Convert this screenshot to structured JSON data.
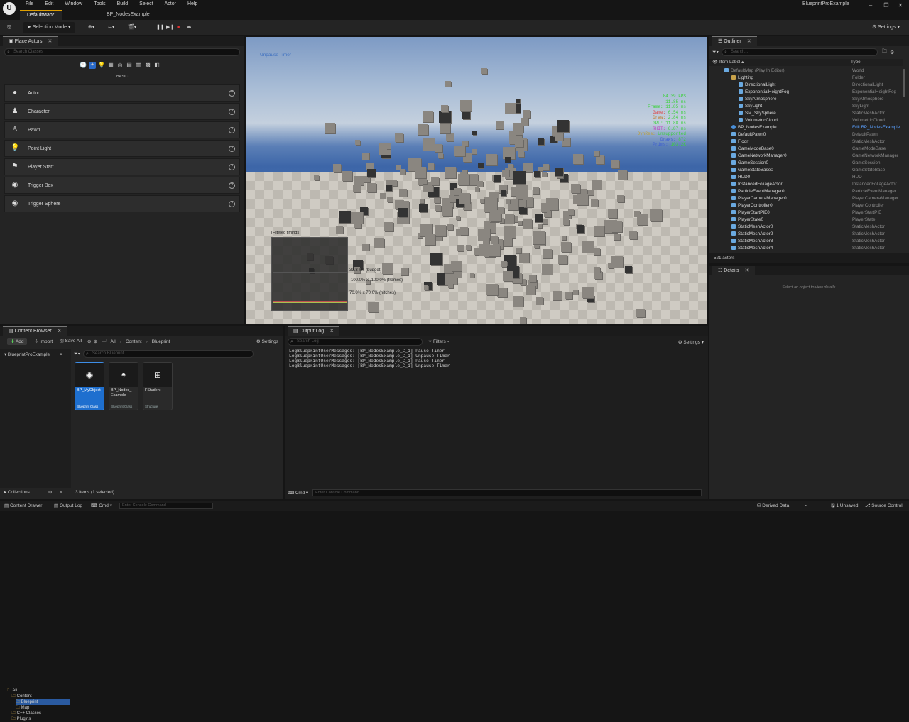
{
  "app": {
    "menu": [
      "File",
      "Edit",
      "Window",
      "Tools",
      "Build",
      "Select",
      "Actor",
      "Help"
    ],
    "tabs": [
      {
        "label": "DefaultMap*",
        "active": true
      },
      {
        "label": "BP_NodesExample",
        "active": false
      }
    ],
    "window_title": "BlueprintProExample",
    "accent": "#e0a000"
  },
  "toolbar": {
    "selection_mode": "Selection Mode",
    "settings_label": "Settings"
  },
  "place_actors": {
    "tab_label": "Place Actors",
    "search_placeholder": "Search Classes",
    "category_label": "BASIC",
    "items": [
      {
        "label": "Actor",
        "icon": "actor-sphere-icon"
      },
      {
        "label": "Character",
        "icon": "character-icon"
      },
      {
        "label": "Pawn",
        "icon": "pawn-icon"
      },
      {
        "label": "Point Light",
        "icon": "light-bulb-icon"
      },
      {
        "label": "Player Start",
        "icon": "flag-icon"
      },
      {
        "label": "Trigger Box",
        "icon": "trigger-box-icon"
      },
      {
        "label": "Trigger Sphere",
        "icon": "trigger-sphere-icon"
      }
    ]
  },
  "viewport": {
    "overlay_text": "Unpause Timer",
    "stats": [
      {
        "label": "",
        "value": "84.39 FPS",
        "color": "#3ad13a"
      },
      {
        "label": "",
        "value": "11.85 ms",
        "color": "#3ad13a"
      },
      {
        "label": "Frame:",
        "value": "11.85 ms",
        "color": "#3ad13a"
      },
      {
        "label": "Game:",
        "value": "6.54 ms",
        "color": "#e04040"
      },
      {
        "label": "Draw:",
        "value": "2.84 ms",
        "color": "#c27a2a"
      },
      {
        "label": "GPU:",
        "value": "11.88 ms",
        "color": "#3ad13a"
      },
      {
        "label": "RHIT:",
        "value": "6.87 ms",
        "color": "#c040c0"
      },
      {
        "label": "DynRes:",
        "value": "Unsupported",
        "color": "#c0a030"
      },
      {
        "label": "Draws:",
        "value": "872",
        "color": "#4060d0"
      },
      {
        "label": "Prims:",
        "value": "103.2K",
        "color": "#4060d0"
      }
    ],
    "graph_title": "(Filtered timings)",
    "graph_labels": [
      "33.3 ms (budget)",
      "-100.0% x -100.0% (frames)",
      "70.0% x 70.0% (hitches)"
    ]
  },
  "outliner": {
    "tab_label": "Outliner",
    "search_placeholder": "Search...",
    "col_label": "Item Label ▴",
    "col_type": "Type",
    "rows": [
      {
        "label": "DefaultMap (Play In Editor)",
        "type": "World",
        "indent": 0,
        "icon": "world-icon"
      },
      {
        "label": "Lighting",
        "type": "Folder",
        "indent": 1,
        "icon": "folder-icon"
      },
      {
        "label": "DirectionalLight",
        "type": "DirectionalLight",
        "indent": 2,
        "icon": "light-icon"
      },
      {
        "label": "ExponentialHeightFog",
        "type": "ExponentialHeightFog",
        "indent": 2,
        "icon": "fog-icon"
      },
      {
        "label": "SkyAtmosphere",
        "type": "SkyAtmosphere",
        "indent": 2,
        "icon": "sky-icon"
      },
      {
        "label": "SkyLight",
        "type": "SkyLight",
        "indent": 2,
        "icon": "light-icon"
      },
      {
        "label": "SM_SkySphere",
        "type": "StaticMeshActor",
        "indent": 2,
        "icon": "mesh-icon"
      },
      {
        "label": "VolumetricCloud",
        "type": "VolumetricCloud",
        "indent": 2,
        "icon": "cloud-icon"
      },
      {
        "label": "BP_NodesExample",
        "type": "Edit BP_NodesExample",
        "indent": 1,
        "icon": "blueprint-icon",
        "link": true
      },
      {
        "label": "DefaultPawn0",
        "type": "DefaultPawn",
        "indent": 1,
        "icon": "pawn-icon"
      },
      {
        "label": "Floor",
        "type": "StaticMeshActor",
        "indent": 1,
        "icon": "mesh-icon"
      },
      {
        "label": "GameModeBase0",
        "type": "GameModeBase",
        "indent": 1,
        "icon": "actor-icon"
      },
      {
        "label": "GameNetworkManager0",
        "type": "GameNetworkManager",
        "indent": 1,
        "icon": "actor-icon"
      },
      {
        "label": "GameSession0",
        "type": "GameSession",
        "indent": 1,
        "icon": "actor-icon"
      },
      {
        "label": "GameStateBase0",
        "type": "GameStateBase",
        "indent": 1,
        "icon": "actor-icon"
      },
      {
        "label": "HUD0",
        "type": "HUD",
        "indent": 1,
        "icon": "actor-icon"
      },
      {
        "label": "InstancedFoliageActor",
        "type": "InstancedFoliageActor",
        "indent": 1,
        "icon": "actor-icon"
      },
      {
        "label": "ParticleEventManager0",
        "type": "ParticleEventManager",
        "indent": 1,
        "icon": "actor-icon"
      },
      {
        "label": "PlayerCameraManager0",
        "type": "PlayerCameraManager",
        "indent": 1,
        "icon": "actor-icon"
      },
      {
        "label": "PlayerController0",
        "type": "PlayerController",
        "indent": 1,
        "icon": "actor-icon"
      },
      {
        "label": "PlayerStartPIE0",
        "type": "PlayerStartPIE",
        "indent": 1,
        "icon": "actor-icon"
      },
      {
        "label": "PlayerState0",
        "type": "PlayerState",
        "indent": 1,
        "icon": "actor-icon"
      },
      {
        "label": "StaticMeshActor0",
        "type": "StaticMeshActor",
        "indent": 1,
        "icon": "mesh-icon"
      },
      {
        "label": "StaticMeshActor2",
        "type": "StaticMeshActor",
        "indent": 1,
        "icon": "mesh-icon"
      },
      {
        "label": "StaticMeshActor3",
        "type": "StaticMeshActor",
        "indent": 1,
        "icon": "mesh-icon"
      },
      {
        "label": "StaticMeshActor4",
        "type": "StaticMeshActor",
        "indent": 1,
        "icon": "mesh-icon"
      }
    ],
    "count": "521 actors"
  },
  "details": {
    "tab_label": "Details",
    "empty_text": "Select an object to view details."
  },
  "content_browser": {
    "tab_label": "Content Browser",
    "add_label": "Add",
    "import_label": "Import",
    "save_all_label": "Save All",
    "breadcrumb": [
      "All",
      "Content",
      "Blueprint"
    ],
    "settings_label": "Settings",
    "project": "BlueprintProExample",
    "search_placeholder": "Search Blueprint",
    "tree": [
      {
        "label": "All",
        "indent": 0
      },
      {
        "label": "Content",
        "indent": 1
      },
      {
        "label": "Blueprint",
        "indent": 2,
        "selected": true
      },
      {
        "label": "Map",
        "indent": 2
      },
      {
        "label": "C++ Classes",
        "indent": 1
      },
      {
        "label": "Plugins",
        "indent": 1
      }
    ],
    "assets": [
      {
        "name": "BP_MyObject",
        "sub": "Blueprint Class",
        "selected": true,
        "icon": "blueprint-object-icon"
      },
      {
        "name": "BP_Nodes_ Example",
        "sub": "Blueprint Class",
        "selected": false,
        "icon": "blueprint-actor-icon"
      },
      {
        "name": "FStudent",
        "sub": "Structure",
        "selected": false,
        "icon": "structure-icon"
      }
    ],
    "collections_label": "Collections",
    "status": "3 items (1 selected)"
  },
  "output_log": {
    "tab_label": "Output Log",
    "search_placeholder": "Search Log",
    "filters_label": "Filters",
    "settings_label": "Settings",
    "lines": [
      "LogBlueprintUserMessages: [BP_NodesExample_C_1] Pause Timer",
      "LogBlueprintUserMessages: [BP_NodesExample_C_1] Unpause Timer",
      "LogBlueprintUserMessages: [BP_NodesExample_C_1] Pause Timer",
      "LogBlueprintUserMessages: [BP_NodesExample_C_1] Unpause Timer"
    ],
    "cmd_label": "Cmd",
    "console_placeholder": "Enter Console Command"
  },
  "statusbar": {
    "content_drawer": "Content Drawer",
    "output_log": "Output Log",
    "cmd": "Cmd",
    "console_placeholder": "Enter Console Command",
    "derived_data": "Derived Data",
    "unsaved": "1 Unsaved",
    "source_control": "Source Control"
  }
}
